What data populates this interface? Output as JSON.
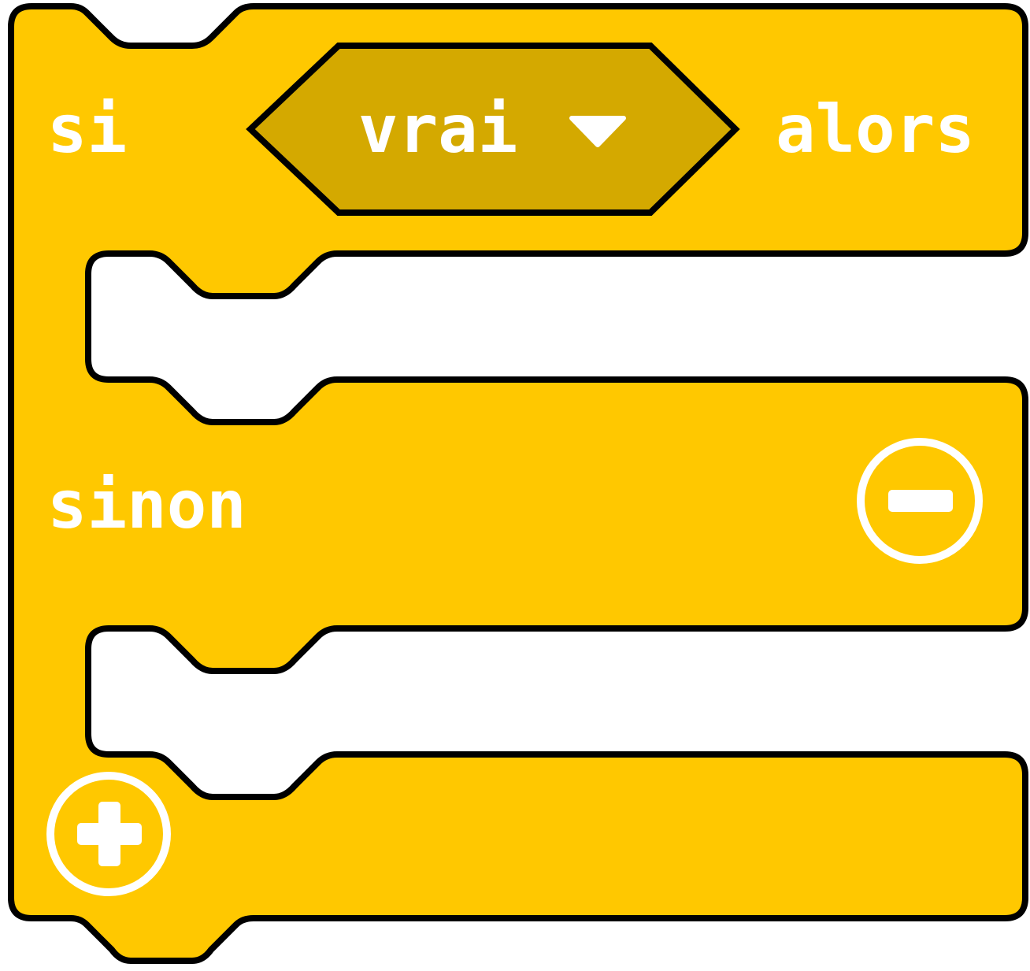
{
  "block": {
    "keyword_if": "si",
    "condition": {
      "value": "vrai",
      "dropdown_icon": "triangle-down-icon"
    },
    "keyword_then": "alors",
    "keyword_else": "sinon",
    "remove_else_icon": "minus-circle-icon",
    "add_branch_icon": "plus-circle-icon",
    "colors": {
      "block_fill": "#FFC800",
      "condition_fill": "#D4A900",
      "outline": "#000000",
      "text": "#FFFFFF",
      "slot": "#FFFFFF"
    }
  }
}
